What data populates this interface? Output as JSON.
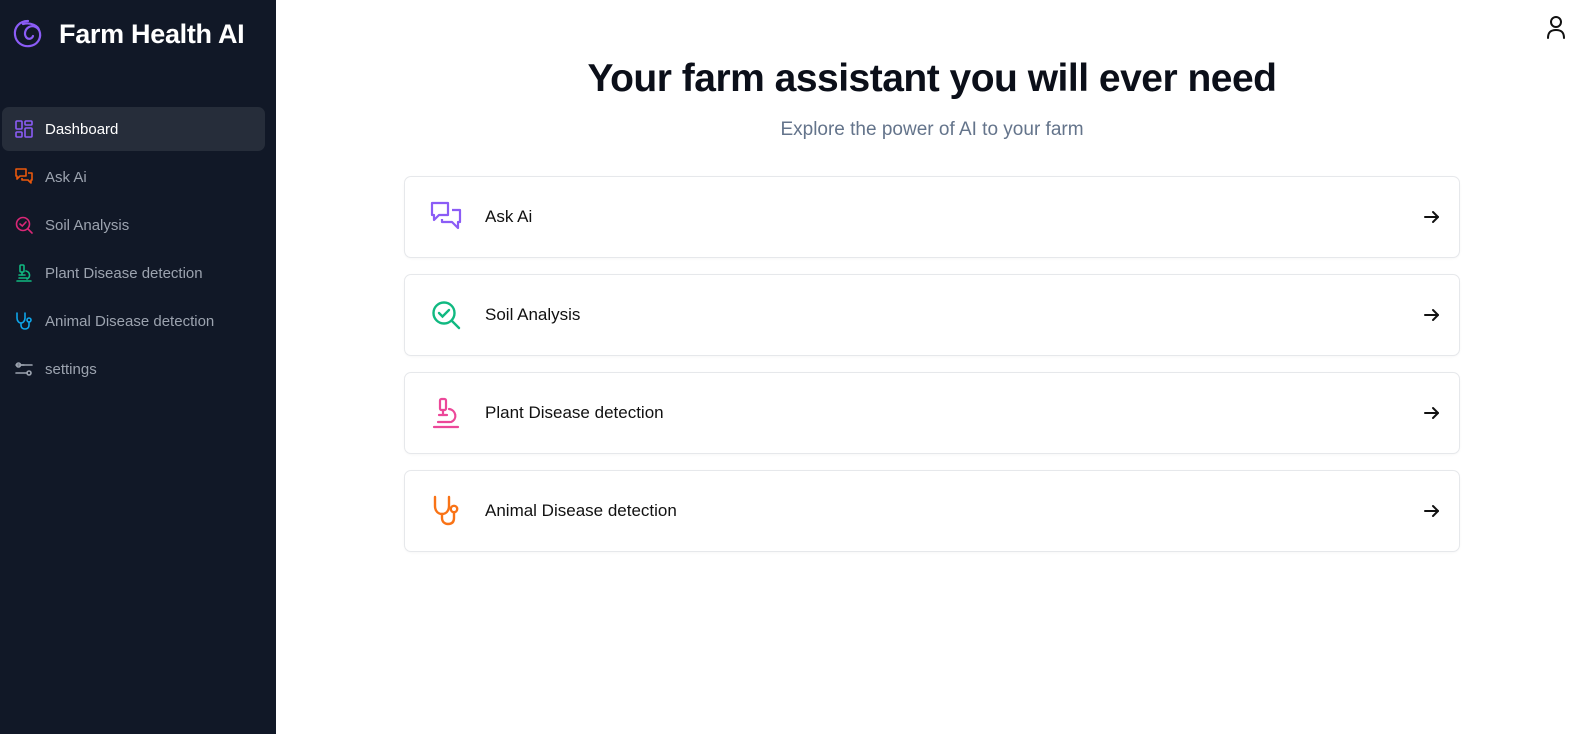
{
  "sidebar": {
    "brand": {
      "title": "Farm Health AI",
      "logo_icon": "swirl-logo-icon",
      "logo_color": "#8b5cf6"
    },
    "items": [
      {
        "label": "Dashboard",
        "icon": "dashboard-grid-icon",
        "color": "#8b5cf6",
        "active": true
      },
      {
        "label": "Ask Ai",
        "icon": "chat-bubbles-icon",
        "color": "#ea580c",
        "active": false
      },
      {
        "label": "Soil Analysis",
        "icon": "search-check-icon",
        "color": "#db2777",
        "active": false
      },
      {
        "label": "Plant Disease detection",
        "icon": "microscope-icon",
        "color": "#10b981",
        "active": false
      },
      {
        "label": "Animal Disease detection",
        "icon": "stethoscope-icon",
        "color": "#0ea5e9",
        "active": false
      },
      {
        "label": "settings",
        "icon": "sliders-icon",
        "color": "#9ca3af",
        "active": false
      }
    ]
  },
  "header": {
    "user_icon": "user-icon"
  },
  "hero": {
    "title": "Your farm assistant you will ever need",
    "subtitle": "Explore the power of AI to your farm"
  },
  "cards": [
    {
      "label": "Ask Ai",
      "icon": "chat-bubbles-icon",
      "color": "#8b5cf6"
    },
    {
      "label": "Soil Analysis",
      "icon": "search-check-icon",
      "color": "#10b981"
    },
    {
      "label": "Plant Disease detection",
      "icon": "microscope-icon",
      "color": "#ec4899"
    },
    {
      "label": "Animal Disease detection",
      "icon": "stethoscope-icon",
      "color": "#f97316"
    }
  ],
  "colors": {
    "sidebar_bg": "#111827",
    "active_item_bg": "#262d3a",
    "subtitle": "#64748b"
  }
}
